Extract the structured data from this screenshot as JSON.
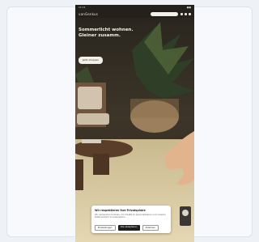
{
  "statusbar": {
    "time": "11:11",
    "indicators": "●●"
  },
  "nav": {
    "logo": "vanGenkus"
  },
  "hero": {
    "title": "Sommerlicht wohnen. Gleiner zusamm.",
    "cta": "Jetzt shoppen"
  },
  "cookie": {
    "title": "Wir respektieren Ihre Privatsphäre",
    "text": "Wir verwenden Cookies, um Inhalte zu personalisieren und unseren Datenverkehr zu analysieren.",
    "btn_settings": "Einstellungen",
    "btn_accept": "Alle akzeptieren",
    "btn_reject": "Ablehnen"
  },
  "colors": {
    "accent": "#1f1f1f",
    "hero_text": "#f3f0ea"
  },
  "icons": [
    "search-icon",
    "heart-icon",
    "cart-icon",
    "menu-icon",
    "chat-icon"
  ]
}
